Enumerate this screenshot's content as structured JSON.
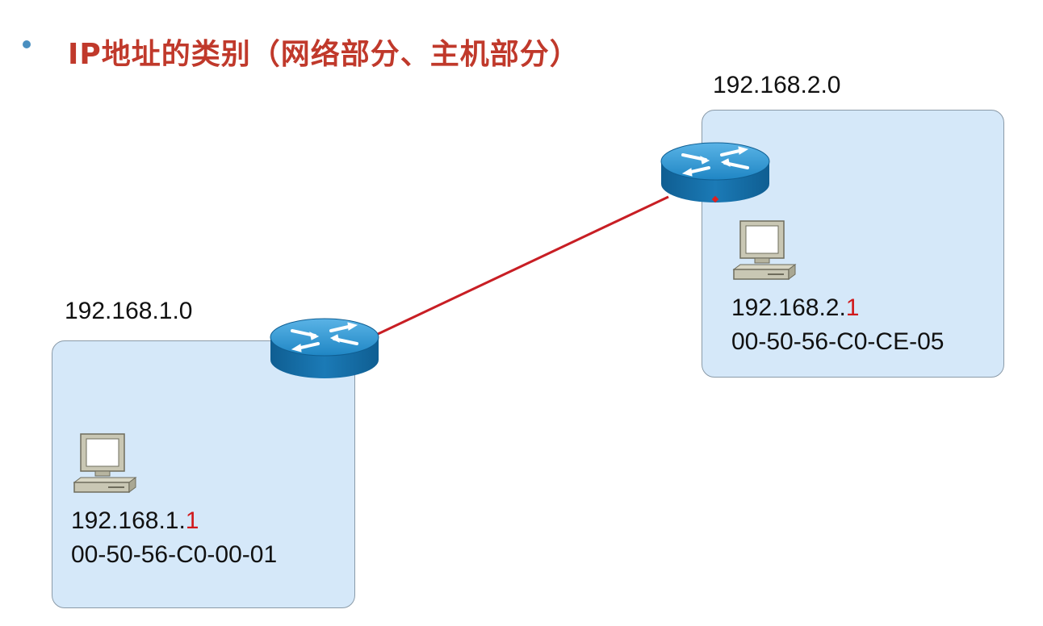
{
  "header": {
    "title": "IP地址的类别（网络部分、主机部分）"
  },
  "networks": [
    {
      "network_address": "192.168.1.0",
      "host_ip_prefix": "192.168.1.",
      "host_ip_suffix": "1",
      "host_mac": "00-50-56-C0-00-01"
    },
    {
      "network_address": "192.168.2.0",
      "host_ip_prefix": "192.168.2.",
      "host_ip_suffix": "1",
      "host_mac": "00-50-56-C0-CE-05"
    }
  ],
  "icons": {
    "router": "router-icon",
    "computer": "computer-icon"
  },
  "colors": {
    "title": "#c0392b",
    "link": "#c81e24",
    "box_fill": "#d5e8f9",
    "router_blue": "#1f86c4",
    "host_suffix": "#d0191c"
  }
}
